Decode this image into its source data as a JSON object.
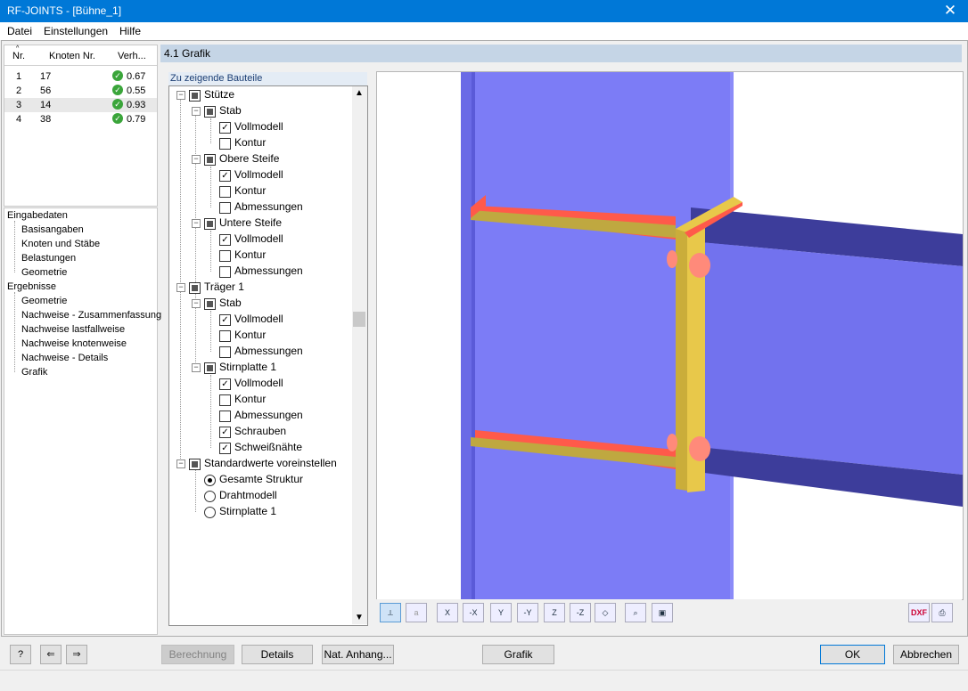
{
  "window": {
    "title": "RF-JOINTS - [Bühne_1]",
    "close_label": "✕"
  },
  "menu": [
    "Datei",
    "Einstellungen",
    "Hilfe"
  ],
  "results_table": {
    "headers": [
      "Nr.",
      "Knoten Nr.",
      "Verh..."
    ],
    "rows": [
      {
        "nr": "1",
        "knoten": "17",
        "verh": "0.67"
      },
      {
        "nr": "2",
        "knoten": "56",
        "verh": "0.55"
      },
      {
        "nr": "3",
        "knoten": "14",
        "verh": "0.93"
      },
      {
        "nr": "4",
        "knoten": "38",
        "verh": "0.79"
      }
    ]
  },
  "nav": {
    "eingabedaten": "Eingabedaten",
    "basisangaben": "Basisangaben",
    "knoten_staebe": "Knoten und Stäbe",
    "belastungen": "Belastungen",
    "geometrie_in": "Geometrie",
    "ergebnisse": "Ergebnisse",
    "geometrie_out": "Geometrie",
    "zusammenfassung": "Nachweise - Zusammenfassung",
    "lastfallweise": "Nachweise lastfallweise",
    "knotenweise": "Nachweise knotenweise",
    "details": "Nachweise - Details",
    "grafik": "Grafik"
  },
  "section_title": "4.1 Grafik",
  "components_tab": "Zu zeigende Bauteile",
  "tree": {
    "stuetze": "Stütze",
    "stab1": "Stab",
    "voll1": "Vollmodell",
    "kontur1": "Kontur",
    "obere": "Obere Steife",
    "voll2": "Vollmodell",
    "kontur2": "Kontur",
    "abm2": "Abmessungen",
    "untere": "Untere Steife",
    "voll3": "Vollmodell",
    "kontur3": "Kontur",
    "abm3": "Abmessungen",
    "traeger": "Träger 1",
    "stab2": "Stab",
    "voll4": "Vollmodell",
    "kontur4": "Kontur",
    "abm4": "Abmessungen",
    "stirn": "Stirnplatte 1",
    "voll5": "Vollmodell",
    "kontur5": "Kontur",
    "abm5": "Abmessungen",
    "schrauben": "Schrauben",
    "schweiss": "Schweißnähte",
    "standard": "Standardwerte voreinstellen",
    "gesamt": "Gesamte Struktur",
    "draht": "Drahtmodell",
    "stirn_opt": "Stirnplatte 1"
  },
  "graphic_toolbar": {
    "x": "X",
    "mx": "-X",
    "y": "Y",
    "my": "-Y",
    "z": "Z",
    "mz": "-Z",
    "dxf": "DXF"
  },
  "buttons": {
    "berechnung": "Berechnung",
    "details": "Details",
    "anhang": "Nat. Anhang...",
    "grafik": "Grafik",
    "ok": "OK",
    "abbrechen": "Abbrechen"
  },
  "colors": {
    "column": "#7f7ff5",
    "beam": "#40409a",
    "plate": "#e3c84e",
    "weld": "#ff5a4a",
    "accent": "#0078d7"
  }
}
